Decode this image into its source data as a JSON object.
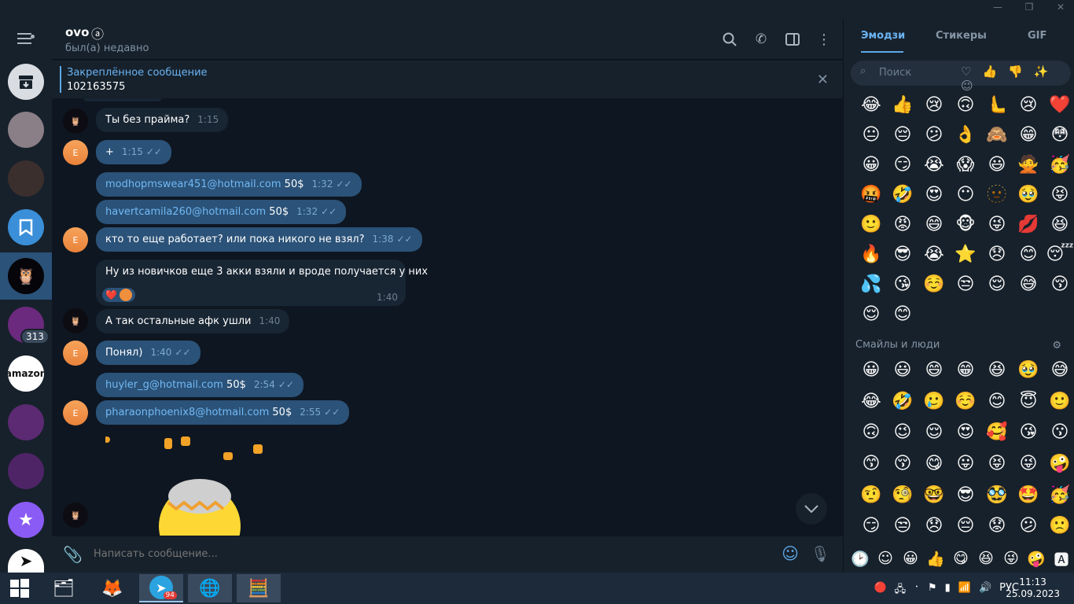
{
  "chat_header": {
    "title": "ovo",
    "status": "был(а) недавно"
  },
  "pinned": {
    "title": "Закреплённое сообщение",
    "text": "102163575"
  },
  "messages": [
    {
      "text": "Ты без прайма?",
      "time": "1:15"
    },
    {
      "text": "+",
      "time": "1:15"
    },
    {
      "text": "modhopmswear451@hotmail.com",
      "suffix": " 50$",
      "time": "1:32"
    },
    {
      "text": "havertcamila260@hotmail.com",
      "suffix": " 50$",
      "time": "1:32"
    },
    {
      "text": "кто то еще работает? или пока никого не взял?",
      "time": "1:38"
    },
    {
      "text": "Ну из новичков еще 3 акки взяли и вроде получается у них",
      "time": "1:40",
      "reaction": "❤️"
    },
    {
      "text": "А так остальные афк ушли",
      "time": "1:40"
    },
    {
      "text": "Понял)",
      "time": "1:40"
    },
    {
      "text": "huyler_g@hotmail.com",
      "suffix": " 50$",
      "time": "2:54"
    },
    {
      "text": "pharaonphoenix8@hotmail.com",
      "suffix": " 50$",
      "time": "2:55"
    }
  ],
  "avatar_letter": "E",
  "input": {
    "placeholder": "Написать сообщение..."
  },
  "sidebar": {
    "unread_badge": "313"
  },
  "emoji_panel": {
    "tabs": [
      "Эмодзи",
      "Стикеры",
      "GIF"
    ],
    "search_placeholder": "Поиск",
    "recent": [
      "😂",
      "👍",
      "😢",
      "🙃",
      "🫷",
      "😢",
      "❤️",
      "😐",
      "😔",
      "😕",
      "👌",
      "🙈",
      "😁",
      "😳",
      "😀",
      "😏",
      "😭",
      "😱",
      "😃",
      "🙅",
      "🥳",
      "🤬",
      "🤣",
      "😍",
      "😶",
      "🫥",
      "🥹",
      "😝",
      "🙂",
      "😡",
      "😄",
      "🐵",
      "😜",
      "💋",
      "😆",
      "🔥",
      "😎",
      "😭",
      "⭐",
      "😞",
      "😊",
      "😴",
      "💦",
      "😘",
      "☺️",
      "😒",
      "😌",
      "😅",
      "😚",
      "😌",
      "😊"
    ],
    "section_title": "Смайлы и люди",
    "people": [
      "😀",
      "😃",
      "😄",
      "😁",
      "😆",
      "🥹",
      "😅",
      "😂",
      "🤣",
      "🥲",
      "☺️",
      "😊",
      "😇",
      "🙂",
      "🙃",
      "😉",
      "😌",
      "😍",
      "🥰",
      "😘",
      "😗",
      "😙",
      "😚",
      "😋",
      "😛",
      "😝",
      "😜",
      "🤪",
      "🤨",
      "🧐",
      "🤓",
      "😎",
      "🥸",
      "🤩",
      "🥳",
      "😏",
      "😒",
      "😞",
      "😔",
      "😟",
      "😕",
      "🙁"
    ],
    "bottom": [
      "🕑",
      "☺",
      "😀",
      "👍",
      "😋",
      "😆",
      "😜",
      "🤪",
      "🅰"
    ]
  },
  "taskbar": {
    "lang": "РУС",
    "time": "11:13",
    "date": "25.09.2023",
    "telegram_badge": "94"
  }
}
